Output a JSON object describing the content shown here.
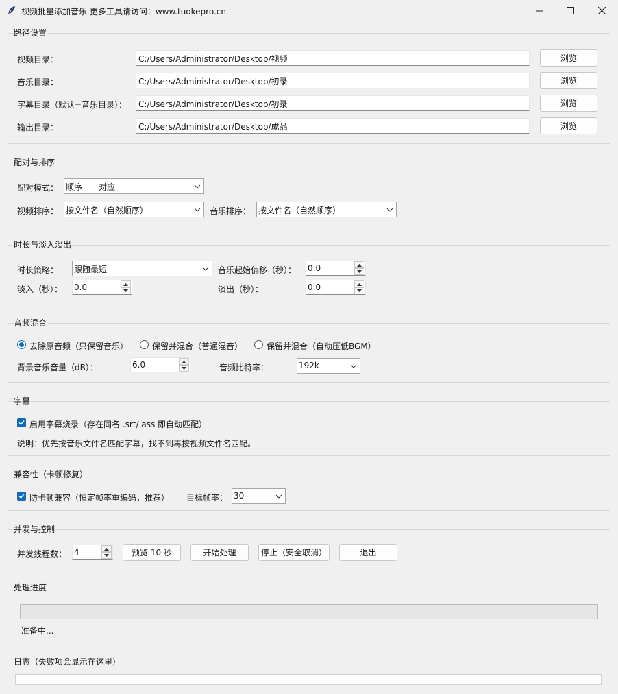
{
  "window": {
    "title": "视频批量添加音乐  更多工具请访问：www.tuokepro.cn",
    "icon": "feather-icon",
    "controls": [
      "minimize-icon",
      "maximize-icon",
      "close-icon"
    ]
  },
  "paths": {
    "group_title": "路径设置",
    "rows": [
      {
        "label": "视频目录：",
        "value": "C:/Users/Administrator/Desktop/视频",
        "button": "浏览"
      },
      {
        "label": "音乐目录：",
        "value": "C:/Users/Administrator/Desktop/初录",
        "button": "浏览"
      },
      {
        "label": "字幕目录（默认=音乐目录）：",
        "value": "C:/Users/Administrator/Desktop/初录",
        "button": "浏览"
      },
      {
        "label": "输出目录：",
        "value": "C:/Users/Administrator/Desktop/成品",
        "button": "浏览"
      }
    ]
  },
  "pairing": {
    "group_title": "配对与排序",
    "mode_label": "配对模式：",
    "mode_value": "顺序一一对应",
    "video_sort_label": "视频排序：",
    "video_sort_value": "按文件名（自然顺序）",
    "music_sort_label": "音乐排序：",
    "music_sort_value": "按文件名（自然顺序）"
  },
  "duration": {
    "group_title": "时长与淡入淡出",
    "strategy_label": "时长策略：",
    "strategy_value": "跟随最短",
    "offset_label": "音乐起始偏移（秒）：",
    "offset_value": "0.0",
    "fade_in_label": "淡入（秒）：",
    "fade_in_value": "0.0",
    "fade_out_label": "淡出（秒）：",
    "fade_out_value": "0.0"
  },
  "audio": {
    "group_title": "音频混合",
    "options": [
      "去除原音频（只保留音乐）",
      "保留并混合（普通混音）",
      "保留并混合（自动压低BGM）"
    ],
    "selected_index": 0,
    "volume_label": "背景音乐音量（dB）：",
    "volume_value": "6.0",
    "bitrate_label": "音频比特率：",
    "bitrate_value": "192k"
  },
  "subtitle": {
    "group_title": "字幕",
    "burn_label": "启用字幕烧录（存在同名 .srt/.ass 即自动匹配）",
    "burn_checked": true,
    "note": "说明：优先按音乐文件名匹配字幕，找不到再按视频文件名匹配。"
  },
  "compat": {
    "group_title": "兼容性（卡顿修复）",
    "anti_stutter_label": "防卡顿兼容（恒定帧率重编码，推荐）",
    "anti_stutter_checked": true,
    "fps_label": "目标帧率：",
    "fps_value": "30"
  },
  "control": {
    "group_title": "并发与控制",
    "threads_label": "并发线程数：",
    "threads_value": "4",
    "preview_button": "预览 10 秒",
    "start_button": "开始处理",
    "stop_button": "停止（安全取消）",
    "exit_button": "退出"
  },
  "progress": {
    "group_title": "处理进度",
    "fraction": 0,
    "status": "准备中..."
  },
  "log": {
    "group_title": "日志（失败项会显示在这里）"
  },
  "colors": {
    "accent": "#0f6cbd",
    "background": "#f0f0f0"
  }
}
